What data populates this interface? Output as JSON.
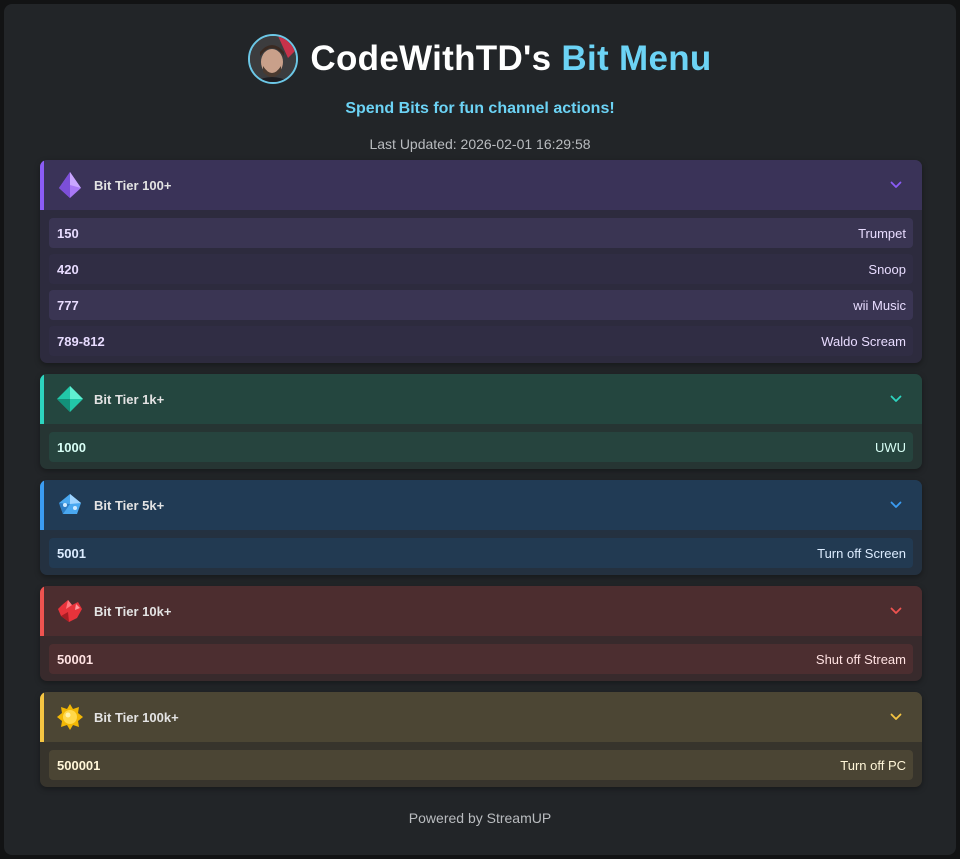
{
  "header": {
    "title_main": "CodeWithTD's",
    "title_accent": "Bit Menu",
    "subtitle": "Spend Bits for fun channel actions!",
    "last_updated": "Last Updated: 2026-02-01 16:29:58"
  },
  "tiers": [
    {
      "label": "Bit Tier 100+",
      "icon": "purple-gem-icon",
      "accent": "#8b5cf6",
      "head_bg": "#3a3358",
      "body_bg": "#2d2b3e",
      "row_bg_a": "#3a3553",
      "row_bg_b": "#302d44",
      "amt_color": "#e8dcff",
      "rows": [
        {
          "amount": "150",
          "action": "Trumpet"
        },
        {
          "amount": "420",
          "action": "Snoop"
        },
        {
          "amount": "777",
          "action": "wii Music"
        },
        {
          "amount": "789-812",
          "action": "Waldo Scream"
        }
      ]
    },
    {
      "label": "Bit Tier 1k+",
      "icon": "teal-gem-icon",
      "accent": "#2dd4bf",
      "head_bg": "#24463f",
      "body_bg": "#263533",
      "row_bg_a": "#26443e",
      "row_bg_b": "#26443e",
      "amt_color": "#d8fff6",
      "rows": [
        {
          "amount": "1000",
          "action": "UWU"
        }
      ]
    },
    {
      "label": "Bit Tier 5k+",
      "icon": "blue-gem-icon",
      "accent": "#3b9cf2",
      "head_bg": "#213b55",
      "body_bg": "#243140",
      "row_bg_a": "#223a52",
      "row_bg_b": "#223a52",
      "amt_color": "#dcecff",
      "rows": [
        {
          "amount": "5001",
          "action": "Turn off Screen"
        }
      ]
    },
    {
      "label": "Bit Tier 10k+",
      "icon": "red-gem-icon",
      "accent": "#ef5350",
      "head_bg": "#4c2d2f",
      "body_bg": "#382a2c",
      "row_bg_a": "#4c2e30",
      "row_bg_b": "#4c2e30",
      "amt_color": "#ffe2e2",
      "rows": [
        {
          "amount": "50001",
          "action": "Shut off Stream"
        }
      ]
    },
    {
      "label": "Bit Tier 100k+",
      "icon": "gold-gem-icon",
      "accent": "#f5c542",
      "head_bg": "#4c4634",
      "body_bg": "#37342c",
      "row_bg_a": "#4b4534",
      "row_bg_b": "#4b4534",
      "amt_color": "#fff6d8",
      "rows": [
        {
          "amount": "500001",
          "action": "Turn off PC"
        }
      ]
    }
  ],
  "footer": "Powered by StreamUP"
}
